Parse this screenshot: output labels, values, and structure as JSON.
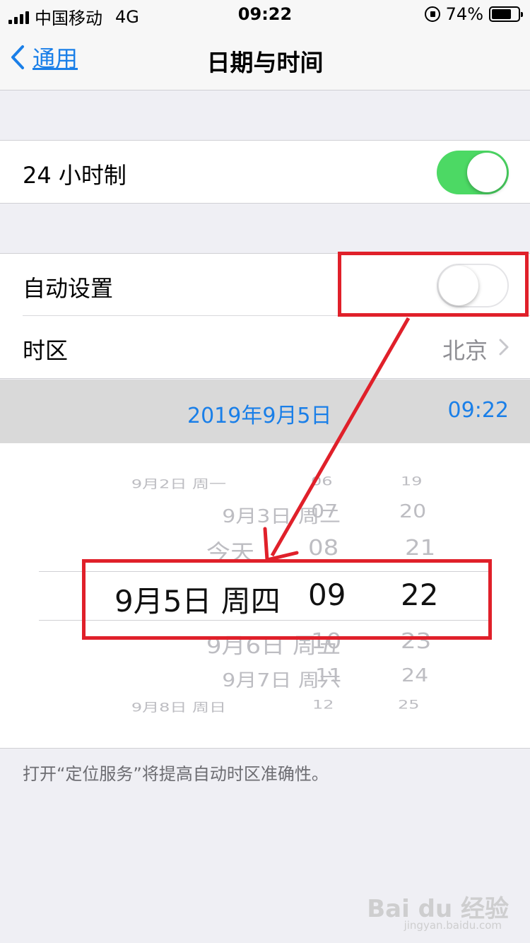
{
  "status_bar": {
    "carrier": "中国移动",
    "network": "4G",
    "time": "09:22",
    "battery_percent": "74%",
    "battery_level": 0.74
  },
  "nav": {
    "back_label": "通用",
    "title": "日期与时间"
  },
  "settings": {
    "hour24_label": "24 小时制",
    "hour24_on": true,
    "auto_label": "自动设置",
    "auto_on": false,
    "timezone_label": "时区",
    "timezone_value": "北京"
  },
  "date_display": {
    "date": "2019年9月5日",
    "time": "09:22"
  },
  "picker": {
    "rows": [
      {
        "date": "9月2日 周一",
        "hour": "06",
        "minute": "19"
      },
      {
        "date": "9月3日 周二",
        "hour": "07",
        "minute": "20"
      },
      {
        "date": "今天",
        "hour": "08",
        "minute": "21"
      },
      {
        "date": "9月5日 周四",
        "hour": "09",
        "minute": "22"
      },
      {
        "date": "9月6日 周五",
        "hour": "10",
        "minute": "23"
      },
      {
        "date": "9月7日 周六",
        "hour": "11",
        "minute": "24"
      },
      {
        "date": "9月8日 周日",
        "hour": "12",
        "minute": "25"
      }
    ]
  },
  "footer": {
    "note": "打开“定位服务”将提高自动时区准确性。"
  },
  "watermark": {
    "brand": "Bai du 经验",
    "url": "jingyan.baidu.com"
  },
  "colors": {
    "accent": "#1a7fe8",
    "toggle_on": "#4cd964",
    "annotation": "#e0202a"
  }
}
